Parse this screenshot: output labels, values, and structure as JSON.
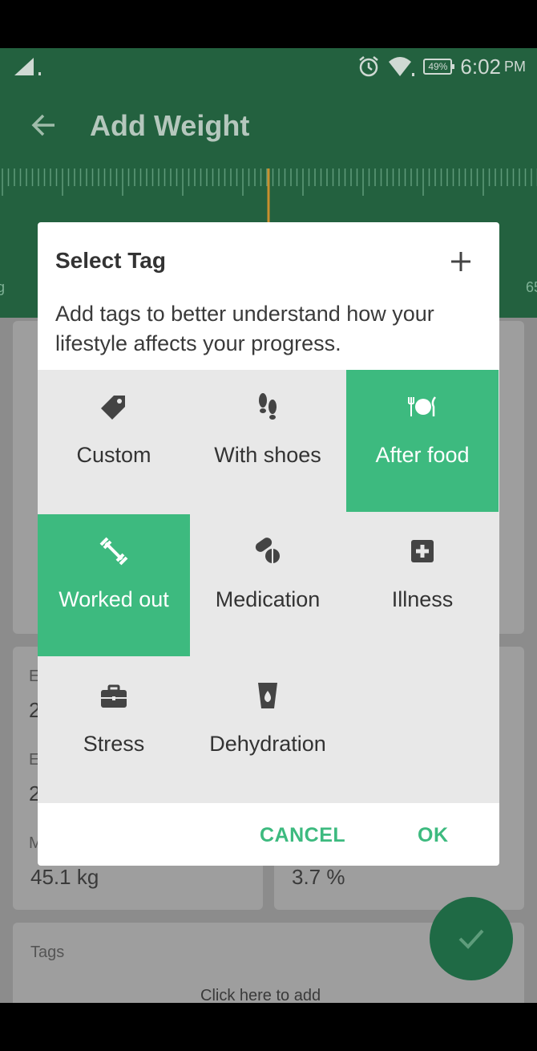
{
  "status_bar": {
    "battery": "49%",
    "time": "6:02",
    "ampm": "PM",
    "icons": [
      "signal-icon",
      "alarm-icon",
      "wifi-icon",
      "battery-icon"
    ]
  },
  "app_bar": {
    "title": "Add Weight"
  },
  "ruler": {
    "left_fragment": "g",
    "right_fragment": "65"
  },
  "background": {
    "stat_1_label": "E",
    "stat_1_value": "2",
    "stat_2_label": "E",
    "stat_2_value": "2",
    "stat_3_label": "M",
    "stat_3_value": "45.1 kg",
    "stat_4_value": "3.7 %",
    "tags_label": "Tags",
    "tags_hint": "Click here to add"
  },
  "dialog": {
    "title": "Select Tag",
    "description": "Add tags to better understand how your lifestyle affects your progress.",
    "tags": [
      {
        "label": "Custom",
        "icon": "tag-icon",
        "selected": false
      },
      {
        "label": "With shoes",
        "icon": "footprints-icon",
        "selected": false
      },
      {
        "label": "After food",
        "icon": "plate-cutlery-icon",
        "selected": true
      },
      {
        "label": "Worked out",
        "icon": "dumbbell-icon",
        "selected": true
      },
      {
        "label": "Medication",
        "icon": "pills-icon",
        "selected": false
      },
      {
        "label": "Illness",
        "icon": "medical-cross-icon",
        "selected": false
      },
      {
        "label": "Stress",
        "icon": "briefcase-icon",
        "selected": false
      },
      {
        "label": "Dehydration",
        "icon": "glass-drop-icon",
        "selected": false
      }
    ],
    "cancel_label": "CANCEL",
    "ok_label": "OK"
  },
  "colors": {
    "primary_dark": "#23613f",
    "accent": "#3dba7f",
    "dialog_bg": "#ffffff",
    "grid_bg": "#e8e8e8"
  }
}
